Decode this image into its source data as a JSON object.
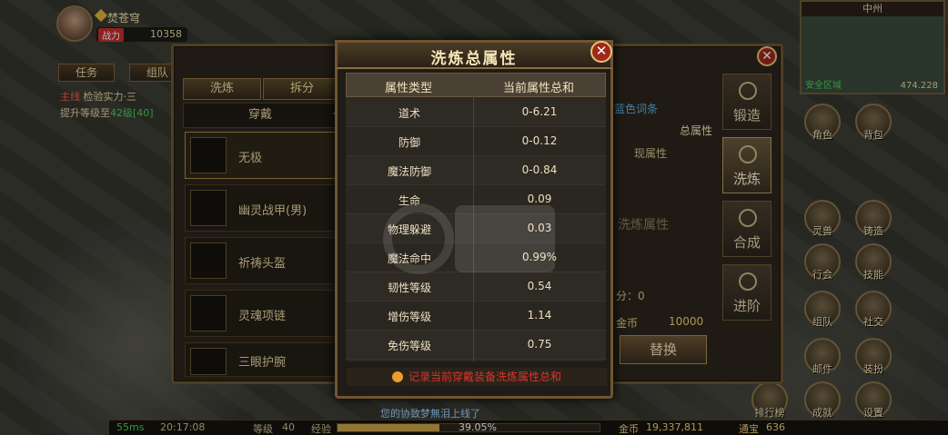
{
  "player": {
    "name": "焚苍穹",
    "power_label": "战力",
    "power": "10358"
  },
  "task_panel": {
    "tabs": [
      "任务",
      "组队"
    ],
    "line1_tag": "主线",
    "line1": "检验实力·三",
    "line2_prefix": "提升等级至",
    "line2_level": "42级",
    "line2_progress": "[40]"
  },
  "forge": {
    "tabs": [
      "洗炼",
      "拆分"
    ],
    "filter": "穿戴",
    "equipment": [
      "无极",
      "幽灵战甲(男)",
      "祈祷头盔",
      "灵魂项链",
      "三眼护腕"
    ],
    "side_buttons": [
      "锻造",
      "洗炼",
      "合成",
      "进阶"
    ],
    "blue_entry_label": "蓝色词条",
    "total_attr_label": "总属性",
    "current_attr_label": "现属性",
    "refine_attr_label": "洗炼属性",
    "points_label": "分：0",
    "gold_label": "金币",
    "gold_value": "10000",
    "swap_button": "替换"
  },
  "minimap": {
    "title": "中州",
    "coords": "474.228",
    "safe": "安全区域"
  },
  "hud": [
    "角色",
    "背包",
    "灵兽",
    "铸造",
    "行会",
    "技能",
    "组队",
    "社交",
    "邮件",
    "装扮",
    "排行榜",
    "成就",
    "设置"
  ],
  "bottom": {
    "ping": "55ms",
    "time": "20:17:08",
    "level_label": "等级",
    "level": "40",
    "exp_label": "经验",
    "exp_percent": "39.05%",
    "exp_value": 0.3905,
    "chat": "您的协致梦無泪上线了",
    "gold_label": "金币",
    "gold": "19,337,811",
    "tongbao_label": "通宝",
    "tongbao": "636"
  },
  "modal": {
    "title": "洗炼总属性",
    "headers": [
      "属性类型",
      "当前属性总和"
    ],
    "rows": [
      {
        "name": "道术",
        "value": "0-6.21"
      },
      {
        "name": "防御",
        "value": "0-0.12"
      },
      {
        "name": "魔法防御",
        "value": "0-0.84"
      },
      {
        "name": "生命",
        "value": "0.09"
      },
      {
        "name": "物理躲避",
        "value": "0.03"
      },
      {
        "name": "魔法命中",
        "value": "0.99%"
      },
      {
        "name": "韧性等级",
        "value": "0.54"
      },
      {
        "name": "增伤等级",
        "value": "1.14"
      },
      {
        "name": "免伤等级",
        "value": "0.75"
      }
    ],
    "note": "记录当前穿戴装备洗炼属性总和"
  },
  "colors": {
    "accent": "#6f5631",
    "close": "#a0281c",
    "note": "#e0322a"
  }
}
